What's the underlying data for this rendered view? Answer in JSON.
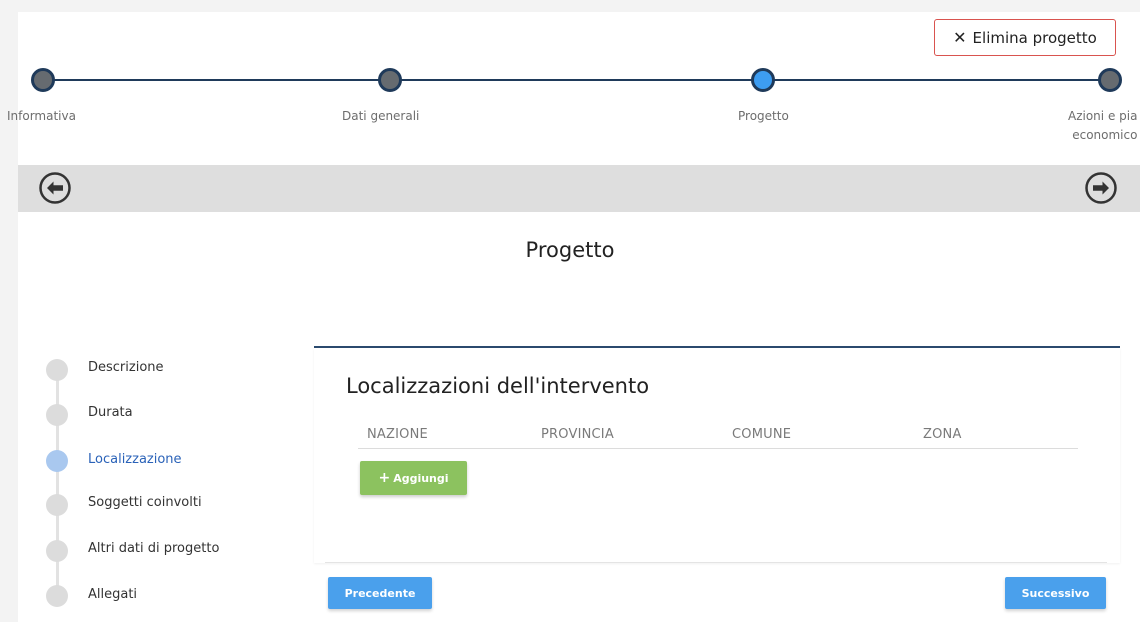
{
  "header": {
    "delete_button": {
      "icon": "close-icon",
      "label": "Elimina progetto",
      "border_color": "#d9534f"
    }
  },
  "stepper": {
    "steps": [
      {
        "label": "Informativa",
        "active": false
      },
      {
        "label": "Dati generali",
        "active": false
      },
      {
        "label": "Progetto",
        "active": true
      },
      {
        "label": "Azioni e piano economico",
        "label_visible_line1": "Azioni e pia",
        "label_visible_line2": "economico",
        "active": false
      }
    ],
    "line_color": "#1f3a5a",
    "active_color": "#3d9df2",
    "inactive_color": "#666b70"
  },
  "nav": {
    "prev_icon": "arrow-left-circle-icon",
    "next_icon": "arrow-right-circle-icon"
  },
  "page": {
    "title": "Progetto"
  },
  "sidebar": {
    "items": [
      {
        "label": "Descrizione",
        "active": false
      },
      {
        "label": "Durata",
        "active": false
      },
      {
        "label": "Localizzazione",
        "active": true
      },
      {
        "label": "Soggetti coinvolti",
        "active": false
      },
      {
        "label": "Altri dati di progetto",
        "active": false
      },
      {
        "label": "Allegati",
        "active": false
      }
    ],
    "active_color": "#2a62b8"
  },
  "main": {
    "section_title": "Localizzazioni dell'intervento",
    "table": {
      "columns": [
        "NAZIONE",
        "PROVINCIA",
        "COMUNE",
        "ZONA"
      ],
      "rows": []
    },
    "add_button": {
      "icon": "plus-icon",
      "label": "Aggiungi",
      "color": "#8cc25f"
    },
    "prev_button": "Precedente",
    "next_button": "Successivo",
    "button_color": "#4aa0ec"
  }
}
